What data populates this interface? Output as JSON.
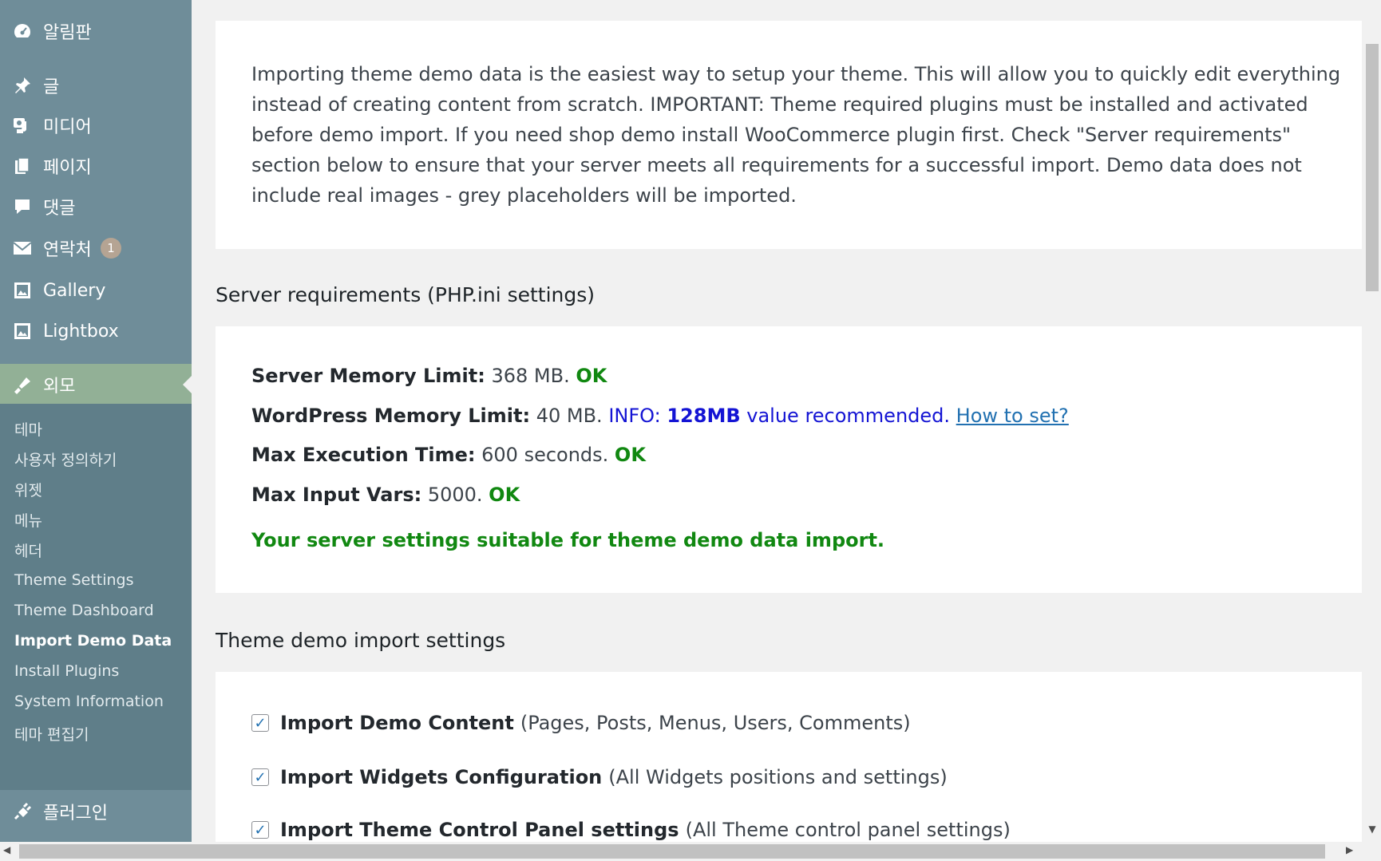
{
  "sidebar": {
    "items": [
      {
        "label": "알림판",
        "icon": "dashboard-icon"
      },
      {
        "label": "글",
        "icon": "pin-icon"
      },
      {
        "label": "미디어",
        "icon": "media-icon"
      },
      {
        "label": "페이지",
        "icon": "pages-icon"
      },
      {
        "label": "댓글",
        "icon": "comments-icon"
      },
      {
        "label": "연락처",
        "icon": "mail-icon",
        "badge": "1"
      },
      {
        "label": "Gallery",
        "icon": "gallery-icon"
      },
      {
        "label": "Lightbox",
        "icon": "lightbox-icon"
      },
      {
        "label": "외모",
        "icon": "appearance-icon"
      },
      {
        "label": "플러그인",
        "icon": "plugins-icon"
      }
    ],
    "submenu": [
      "테마",
      "사용자 정의하기",
      "위젯",
      "메뉴",
      "헤더",
      "Theme Settings",
      "Theme Dashboard",
      "Import Demo Data",
      "Install Plugins",
      "System Information",
      "테마 편집기"
    ]
  },
  "intro": {
    "text": "Importing theme demo data is the easiest way to setup your theme. This will allow you to quickly edit everything instead of creating content from scratch. IMPORTANT: Theme required plugins must be installed and activated before demo import. If you need shop demo install WooCommerce plugin first. Check \"Server requirements\" section below to ensure that your server meets all requirements for a successful import. Demo data does not include real images - grey placeholders will be imported."
  },
  "server": {
    "title": "Server requirements (PHP.ini settings)",
    "memory_label": "Server Memory Limit:",
    "memory_value": " 368 MB. ",
    "memory_status": "OK",
    "wp_label": "WordPress Memory Limit:",
    "wp_value": " 40 MB. ",
    "wp_info_prefix": "INFO: ",
    "wp_info_bold": "128MB",
    "wp_info_suffix": " value recommended. ",
    "wp_link": "How to set?",
    "exec_label": "Max Execution Time:",
    "exec_value": " 600 seconds. ",
    "exec_status": "OK",
    "vars_label": "Max Input Vars:",
    "vars_value": " 5000. ",
    "vars_status": "OK",
    "success": "Your server settings suitable for theme demo data import."
  },
  "import_settings": {
    "title": "Theme demo import settings",
    "options": [
      {
        "label": "Import Demo Content",
        "desc": "(Pages, Posts, Menus, Users, Comments)",
        "checked": true
      },
      {
        "label": "Import Widgets Configuration",
        "desc": "(All Widgets positions and settings)",
        "checked": true
      },
      {
        "label": "Import Theme Control Panel settings",
        "desc": "(All Theme control panel settings)",
        "checked": true
      }
    ]
  }
}
